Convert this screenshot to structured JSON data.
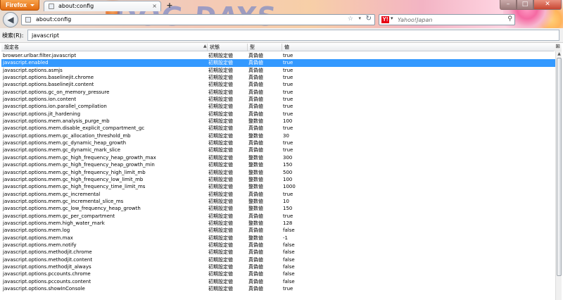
{
  "window": {
    "app_button": "Firefox",
    "tab_title": "about:config",
    "new_tab": "+",
    "min": "–",
    "max": "□",
    "close": "✕"
  },
  "toolbar": {
    "back": "◀",
    "url": "about:config",
    "star": "☆",
    "url_drop": "▾",
    "reload": "↻",
    "search_placeholder": "Yahoo!Japan",
    "search_engine_logo": "Y!",
    "search_engine_drop": "▾",
    "search_icon": "⚲"
  },
  "banner_text": "DOG DAYS",
  "filter": {
    "label": "検索(R):",
    "value": "javascript"
  },
  "columns": {
    "name": "設定名",
    "status": "状態",
    "type": "型",
    "value": "値",
    "sort_arrow": "▲",
    "picker": "⊞"
  },
  "rows": [
    {
      "name": "browser.urlbar.filter.javascript",
      "status": "初期設定値",
      "type": "真偽値",
      "value": "true"
    },
    {
      "name": "javascript.enabled",
      "status": "初期設定値",
      "type": "真偽値",
      "value": "true",
      "selected": true
    },
    {
      "name": "javascript.options.asmjs",
      "status": "初期設定値",
      "type": "真偽値",
      "value": "true"
    },
    {
      "name": "javascript.options.baselinejit.chrome",
      "status": "初期設定値",
      "type": "真偽値",
      "value": "true"
    },
    {
      "name": "javascript.options.baselinejit.content",
      "status": "初期設定値",
      "type": "真偽値",
      "value": "true"
    },
    {
      "name": "javascript.options.gc_on_memory_pressure",
      "status": "初期設定値",
      "type": "真偽値",
      "value": "true"
    },
    {
      "name": "javascript.options.ion.content",
      "status": "初期設定値",
      "type": "真偽値",
      "value": "true"
    },
    {
      "name": "javascript.options.ion.parallel_compilation",
      "status": "初期設定値",
      "type": "真偽値",
      "value": "true"
    },
    {
      "name": "javascript.options.jit_hardening",
      "status": "初期設定値",
      "type": "真偽値",
      "value": "true"
    },
    {
      "name": "javascript.options.mem.analysis_purge_mb",
      "status": "初期設定値",
      "type": "整数値",
      "value": "100"
    },
    {
      "name": "javascript.options.mem.disable_explicit_compartment_gc",
      "status": "初期設定値",
      "type": "真偽値",
      "value": "true"
    },
    {
      "name": "javascript.options.mem.gc_allocation_threshold_mb",
      "status": "初期設定値",
      "type": "整数値",
      "value": "30"
    },
    {
      "name": "javascript.options.mem.gc_dynamic_heap_growth",
      "status": "初期設定値",
      "type": "真偽値",
      "value": "true"
    },
    {
      "name": "javascript.options.mem.gc_dynamic_mark_slice",
      "status": "初期設定値",
      "type": "真偽値",
      "value": "true"
    },
    {
      "name": "javascript.options.mem.gc_high_frequency_heap_growth_max",
      "status": "初期設定値",
      "type": "整数値",
      "value": "300"
    },
    {
      "name": "javascript.options.mem.gc_high_frequency_heap_growth_min",
      "status": "初期設定値",
      "type": "整数値",
      "value": "150"
    },
    {
      "name": "javascript.options.mem.gc_high_frequency_high_limit_mb",
      "status": "初期設定値",
      "type": "整数値",
      "value": "500"
    },
    {
      "name": "javascript.options.mem.gc_high_frequency_low_limit_mb",
      "status": "初期設定値",
      "type": "整数値",
      "value": "100"
    },
    {
      "name": "javascript.options.mem.gc_high_frequency_time_limit_ms",
      "status": "初期設定値",
      "type": "整数値",
      "value": "1000"
    },
    {
      "name": "javascript.options.mem.gc_incremental",
      "status": "初期設定値",
      "type": "真偽値",
      "value": "true"
    },
    {
      "name": "javascript.options.mem.gc_incremental_slice_ms",
      "status": "初期設定値",
      "type": "整数値",
      "value": "10"
    },
    {
      "name": "javascript.options.mem.gc_low_frequency_heap_growth",
      "status": "初期設定値",
      "type": "整数値",
      "value": "150"
    },
    {
      "name": "javascript.options.mem.gc_per_compartment",
      "status": "初期設定値",
      "type": "真偽値",
      "value": "true"
    },
    {
      "name": "javascript.options.mem.high_water_mark",
      "status": "初期設定値",
      "type": "整数値",
      "value": "128"
    },
    {
      "name": "javascript.options.mem.log",
      "status": "初期設定値",
      "type": "真偽値",
      "value": "false"
    },
    {
      "name": "javascript.options.mem.max",
      "status": "初期設定値",
      "type": "整数値",
      "value": "-1"
    },
    {
      "name": "javascript.options.mem.notify",
      "status": "初期設定値",
      "type": "真偽値",
      "value": "false"
    },
    {
      "name": "javascript.options.methodjit.chrome",
      "status": "初期設定値",
      "type": "真偽値",
      "value": "false"
    },
    {
      "name": "javascript.options.methodjit.content",
      "status": "初期設定値",
      "type": "真偽値",
      "value": "false"
    },
    {
      "name": "javascript.options.methodjit_always",
      "status": "初期設定値",
      "type": "真偽値",
      "value": "false"
    },
    {
      "name": "javascript.options.pccounts.chrome",
      "status": "初期設定値",
      "type": "真偽値",
      "value": "false"
    },
    {
      "name": "javascript.options.pccounts.content",
      "status": "初期設定値",
      "type": "真偽値",
      "value": "false"
    },
    {
      "name": "javascript.options.showInConsole",
      "status": "初期設定値",
      "type": "真偽値",
      "value": "true"
    }
  ]
}
